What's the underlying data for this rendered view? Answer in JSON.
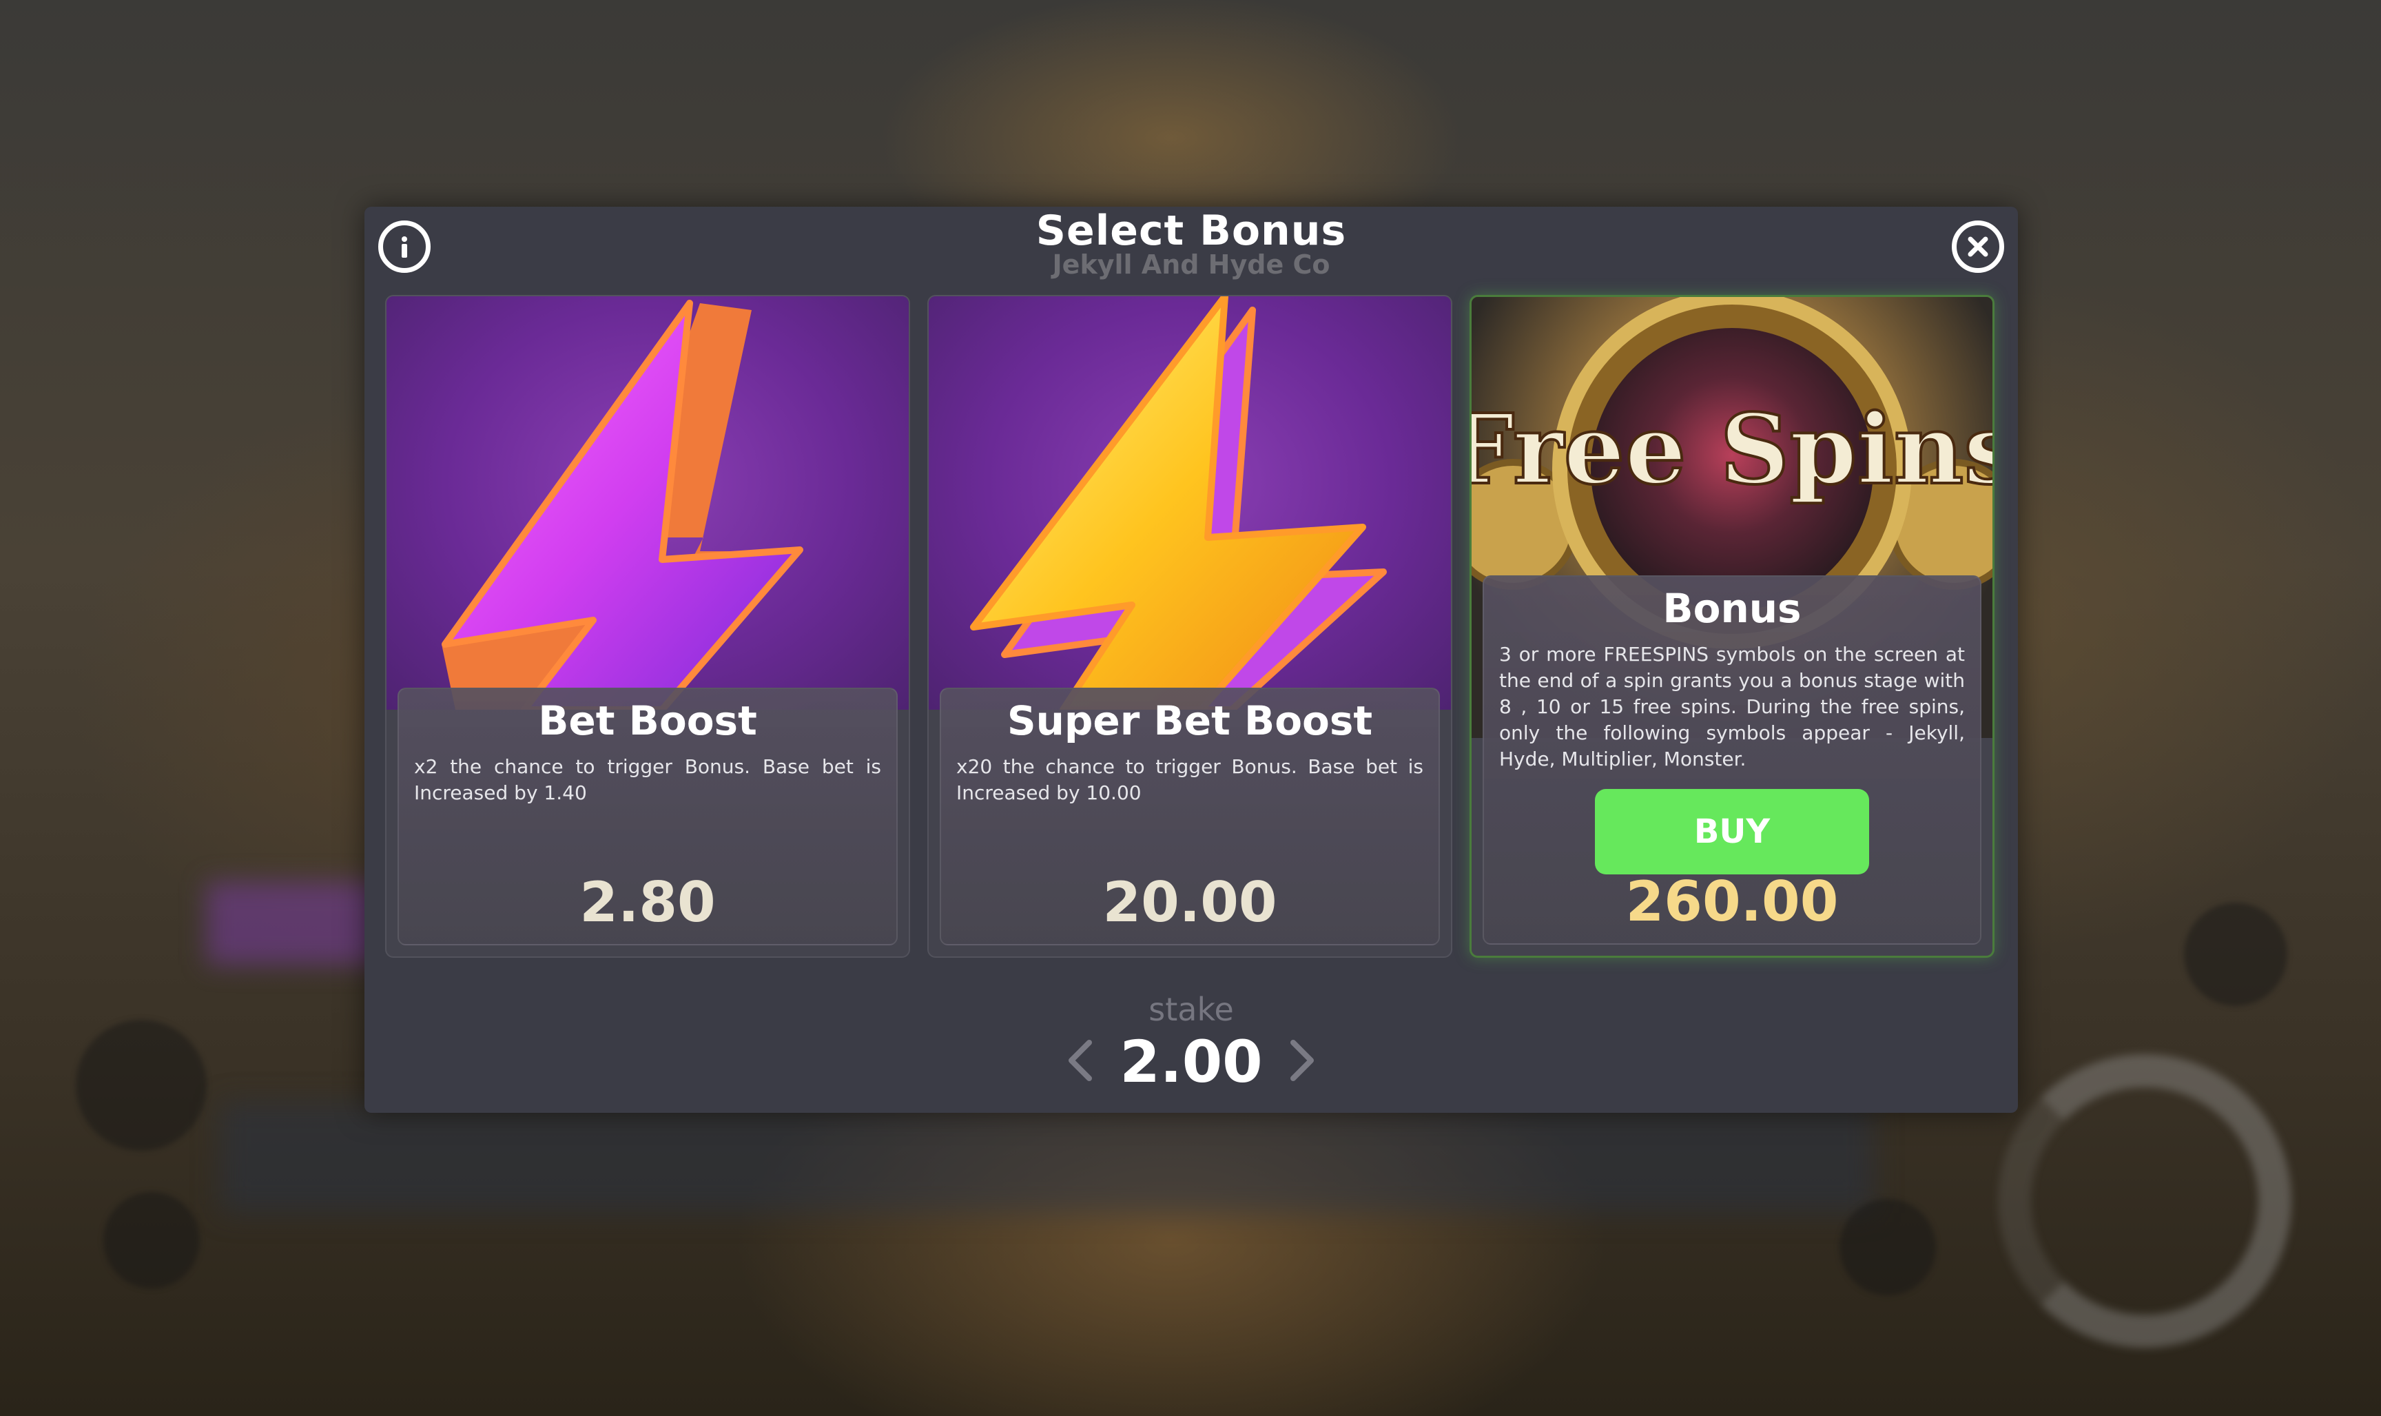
{
  "modal": {
    "title": "Select Bonus",
    "subtitle": "Jekyll And Hyde Co",
    "info_icon": "info-icon",
    "close_icon": "close-circle-icon"
  },
  "cards": [
    {
      "title": "Bet Boost",
      "description": "x2 the chance to trigger Bonus. Base bet is Increased by 1.40",
      "price": "2.80",
      "art": "purple-lightning-bolt-icon"
    },
    {
      "title": "Super Bet Boost",
      "description": "x20 the chance to trigger Bonus. Base bet is Increased by 10.00",
      "price": "20.00",
      "art": "yellow-lightning-bolt-icon"
    },
    {
      "title": "Bonus",
      "description": "3 or more FREESPINS symbols on the screen at the end of a spin grants you a bonus stage with 8 , 10 or 15 free spins. During the free spins, only the following symbols appear - Jekyll, Hyde, Multiplier, Monster.",
      "price": "260.00",
      "button_label": "BUY",
      "art_text": "Free Spins",
      "selected": true
    }
  ],
  "stake": {
    "label": "stake",
    "value": "2.00"
  },
  "colors": {
    "modal_bg": "#3b3c46",
    "buy_button": "#66e85c",
    "selected_border": "#4a7c3c",
    "bonus_price": "#f6d98a"
  }
}
